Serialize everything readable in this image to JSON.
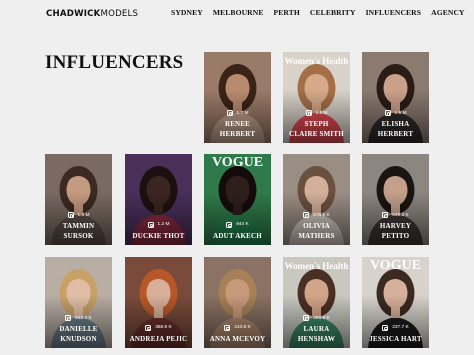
{
  "brand": {
    "bold": "CHADWICK",
    "light": "MODELS"
  },
  "nav": [
    "SYDNEY",
    "MELBOURNE",
    "PERTH",
    "CELEBRITY",
    "INFLUENCERS",
    "AGENCY"
  ],
  "page_title": "INFLUENCERS",
  "models": [
    {
      "first": "RENEE",
      "last": "HERBERT",
      "followers": "1.7 M",
      "bg": "#9a7a68",
      "skin": "#b88a6e",
      "hair": "#3a2418",
      "top": "#bfa08c"
    },
    {
      "first": "STEPH",
      "last": "CLAIRE SMITH",
      "followers": "1.6 M",
      "bg": "#d8d2c8",
      "skin": "#d7a98a",
      "hair": "#a46f48",
      "top": "#e34a55",
      "magazine": "Women's Health"
    },
    {
      "first": "ELISHA",
      "last": "HERBERT",
      "followers": "1.6 M",
      "bg": "#8a7a70",
      "skin": "#c9a08a",
      "hair": "#2a1c16",
      "top": "#2e2a2a"
    },
    {
      "first": "TAMMIN",
      "last": "SURSOK",
      "followers": "1.3 M",
      "bg": "#7a6a62",
      "skin": "#c49a80",
      "hair": "#3b2a22",
      "top": "#5b4d47"
    },
    {
      "first": "DUCKIE THOT",
      "last": "",
      "followers": "1.2 M",
      "bg": "#4a2f5a",
      "skin": "#3b2520",
      "hair": "#1d1010",
      "top": "#8a2a3e"
    },
    {
      "first": "ADUT AKECH",
      "last": "",
      "followers": "944 K",
      "bg": "#2f7a4a",
      "skin": "#2e1f1a",
      "hair": "#140c0a",
      "top": "#22844c",
      "magazine": "VOGUE"
    },
    {
      "first": "OLIVIA",
      "last": "MATHERS",
      "followers": "576.6 K",
      "bg": "#9a8e84",
      "skin": "#d2b09a",
      "hair": "#6b5040",
      "top": "#cfc6bd"
    },
    {
      "first": "HARVEY",
      "last": "PETITO",
      "followers": "549.3 K",
      "bg": "#8c8680",
      "skin": "#c2a08c",
      "hair": "#1a1412",
      "top": "#3d3632"
    },
    {
      "first": "DANIELLE",
      "last": "KNUDSON",
      "followers": "512.4 K",
      "bg": "#b8aea4",
      "skin": "#e0bea6",
      "hair": "#c9a068",
      "top": "#6b7f8a"
    },
    {
      "first": "ANDREJA PEJIC",
      "last": "",
      "followers": "368.6 K",
      "bg": "#7a4b3a",
      "skin": "#d8b09a",
      "hair": "#b8582a",
      "top": "#6a2f2a"
    },
    {
      "first": "ANNA MCEVOY",
      "last": "",
      "followers": "310.6 K",
      "bg": "#8a7264",
      "skin": "#c89a7c",
      "hair": "#a88058",
      "top": "#b08a70"
    },
    {
      "first": "LAURA",
      "last": "HENSHAW",
      "followers": "286.6 K",
      "bg": "#c8c8c0",
      "skin": "#d2a488",
      "hair": "#4a3024",
      "top": "#3a8a6a",
      "magazine": "Women's Health"
    },
    {
      "first": "JESSICA HART",
      "last": "",
      "followers": "237.7 K",
      "bg": "#d7d2cc",
      "skin": "#d6b09a",
      "hair": "#3a2a22",
      "top": "#1c1c1c",
      "magazine": "VOGUE"
    }
  ]
}
